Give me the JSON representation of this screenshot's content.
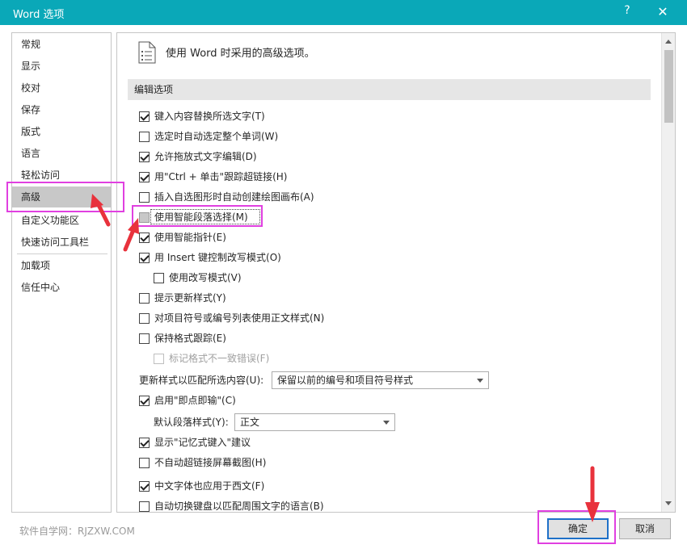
{
  "window": {
    "title": "Word 选项",
    "help_glyph": "?",
    "close_glyph": "✕"
  },
  "nav": {
    "items": [
      "常规",
      "显示",
      "校对",
      "保存",
      "版式",
      "语言",
      "轻松访问",
      "高级",
      "自定义功能区",
      "快速访问工具栏",
      "加载项",
      "信任中心"
    ],
    "selected": "高级"
  },
  "pane": {
    "heading": "使用 Word 时采用的高级选项。",
    "section": "编辑选项",
    "options": [
      {
        "label": "键入内容替换所选文字(T)",
        "checked": true
      },
      {
        "label": "选定时自动选定整个单词(W)",
        "checked": false
      },
      {
        "label": "允许拖放式文字编辑(D)",
        "checked": true
      },
      {
        "label": "用\"Ctrl + 单击\"跟踪超链接(H)",
        "checked": true
      },
      {
        "label": "插入自选图形时自动创建绘图画布(A)",
        "checked": false
      },
      {
        "label": "使用智能段落选择(M)",
        "checked": false,
        "highlighted": true
      },
      {
        "label": "使用智能指针(E)",
        "checked": true
      },
      {
        "label": "用 Insert 键控制改写模式(O)",
        "checked": true
      },
      {
        "label": "使用改写模式(V)",
        "checked": false,
        "indent": true
      },
      {
        "label": "提示更新样式(Y)",
        "checked": false
      },
      {
        "label": "对项目符号或编号列表使用正文样式(N)",
        "checked": false
      },
      {
        "label": "保持格式跟踪(E)",
        "checked": false
      },
      {
        "label": "标记格式不一致错误(F)",
        "checked": false,
        "indent": true,
        "disabled": true
      }
    ],
    "update_style": {
      "label": "更新样式以匹配所选内容(U):",
      "value": "保留以前的编号和项目符号样式"
    },
    "click_type": {
      "label": "启用\"即点即输\"(C)",
      "checked": true
    },
    "default_para": {
      "label": "默认段落样式(Y):",
      "value": "正文"
    },
    "options2": [
      {
        "label": "显示\"记忆式键入\"建议",
        "checked": true
      },
      {
        "label": "不自动超链接屏幕截图(H)",
        "checked": false
      },
      {
        "label": "中文字体也应用于西文(F)",
        "checked": true
      },
      {
        "label": "自动切换键盘以匹配周围文字的语言(B)",
        "checked": false
      }
    ]
  },
  "footer": {
    "watermark": "软件自学网：RJZXW.COM",
    "ok_label": "确定",
    "cancel_label": "取消"
  },
  "colors": {
    "titlebar": "#0aa8b8",
    "annotation": "#e040e0",
    "arrow": "#e8323c",
    "default_button_border": "#1e70c8"
  }
}
